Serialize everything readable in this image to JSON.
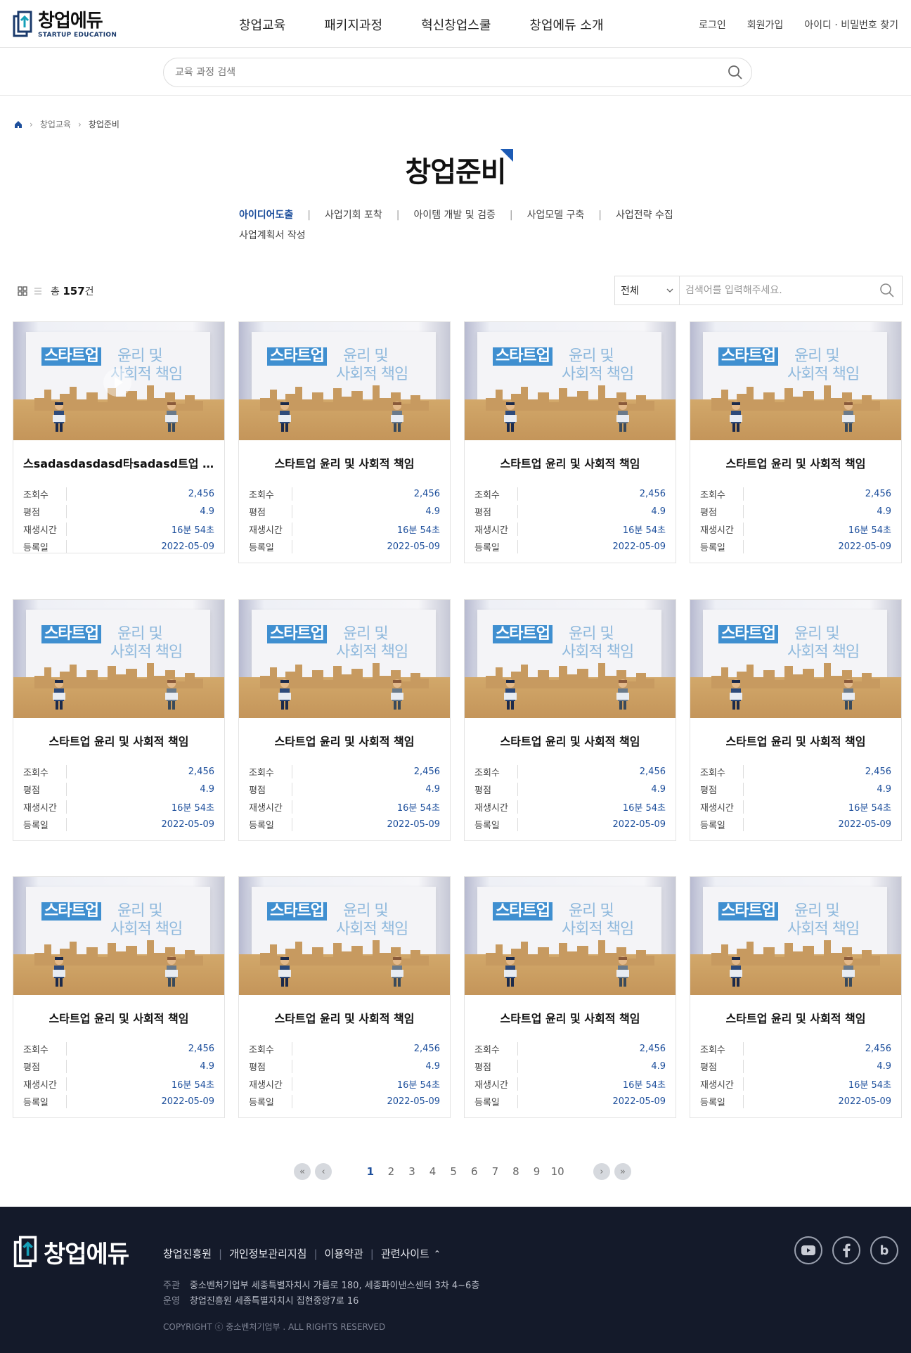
{
  "header": {
    "logo_title": "창업에듀",
    "logo_sub": "STARTUP EDUCATION",
    "nav": [
      "창업교육",
      "패키지과정",
      "혁신창업스쿨",
      "창업에듀 소개"
    ],
    "util": [
      "로그인",
      "회원가입",
      "아이디 · 비밀번호 찾기"
    ]
  },
  "top_search": {
    "placeholder": "교육 과정 검색"
  },
  "breadcrumb": {
    "level1": "창업교육",
    "current": "창업준비"
  },
  "page_title": "창업준비",
  "categories": [
    {
      "label": "아이디어도출",
      "active": true
    },
    {
      "label": "사업기회 포착",
      "active": false
    },
    {
      "label": "아이템 개발 및 검증",
      "active": false
    },
    {
      "label": "사업모델 구축",
      "active": false
    },
    {
      "label": "사업전략 수집",
      "active": false
    },
    {
      "label": "사업계획서 작성",
      "active": false
    }
  ],
  "list": {
    "total_prefix": "총",
    "total_count": "157",
    "total_suffix": "건",
    "filter_select": "전체",
    "filter_placeholder": "검색어를 입력해주세요."
  },
  "thumbnail": {
    "line1a": "스타트업",
    "line1b": "윤리 및",
    "line2": "사회적 책임"
  },
  "meta_labels": {
    "views": "조회수",
    "rating": "평점",
    "duration": "재생시간",
    "date": "등록일"
  },
  "cards": [
    {
      "title": "스sadasdasdasd타sadasd트업 윤리 및 사회적 책임",
      "views": "2,456",
      "rating": "4.9",
      "duration": "16분 54초",
      "date": "2022-05-09"
    },
    {
      "title": "스타트업 윤리 및 사회적 책임",
      "views": "2,456",
      "rating": "4.9",
      "duration": "16분 54초",
      "date": "2022-05-09"
    },
    {
      "title": "스타트업 윤리 및 사회적 책임",
      "views": "2,456",
      "rating": "4.9",
      "duration": "16분 54초",
      "date": "2022-05-09"
    },
    {
      "title": "스타트업 윤리 및 사회적 책임",
      "views": "2,456",
      "rating": "4.9",
      "duration": "16분 54초",
      "date": "2022-05-09"
    },
    {
      "title": "스타트업 윤리 및 사회적 책임",
      "views": "2,456",
      "rating": "4.9",
      "duration": "16분 54초",
      "date": "2022-05-09"
    },
    {
      "title": "스타트업 윤리 및 사회적 책임",
      "views": "2,456",
      "rating": "4.9",
      "duration": "16분 54초",
      "date": "2022-05-09"
    },
    {
      "title": "스타트업 윤리 및 사회적 책임",
      "views": "2,456",
      "rating": "4.9",
      "duration": "16분 54초",
      "date": "2022-05-09"
    },
    {
      "title": "스타트업 윤리 및 사회적 책임",
      "views": "2,456",
      "rating": "4.9",
      "duration": "16분 54초",
      "date": "2022-05-09"
    },
    {
      "title": "스타트업 윤리 및 사회적 책임",
      "views": "2,456",
      "rating": "4.9",
      "duration": "16분 54초",
      "date": "2022-05-09"
    },
    {
      "title": "스타트업 윤리 및 사회적 책임",
      "views": "2,456",
      "rating": "4.9",
      "duration": "16분 54초",
      "date": "2022-05-09"
    },
    {
      "title": "스타트업 윤리 및 사회적 책임",
      "views": "2,456",
      "rating": "4.9",
      "duration": "16분 54초",
      "date": "2022-05-09"
    },
    {
      "title": "스타트업 윤리 및 사회적 책임",
      "views": "2,456",
      "rating": "4.9",
      "duration": "16분 54초",
      "date": "2022-05-09"
    }
  ],
  "pagination": {
    "pages": [
      "1",
      "2",
      "3",
      "4",
      "5",
      "6",
      "7",
      "8",
      "9",
      "10"
    ],
    "current": "1"
  },
  "footer": {
    "logo_title": "창업에듀",
    "links": [
      "창업진흥원",
      "개인정보관리지침",
      "이용약관",
      "관련사이트"
    ],
    "host_label": "주관",
    "host_text": "중소벤처기업부   세종특별자치시 가름로 180, 세종파이낸스센터 3차 4~6층",
    "operator_label": "운영",
    "operator_text": "창업진흥원   세종특별자치시 집현중앙7로 16",
    "copyright": "COPYRIGHT ⓒ 중소벤처기업부 . ALL RIGHTS RESERVED",
    "sns": [
      "youtube-icon",
      "facebook-icon",
      "blog-icon"
    ],
    "blog_letter": "b"
  },
  "colors": {
    "accent": "#1d4f9c",
    "footer_bg": "#141a2a",
    "thumb_title_bg": "#3f8fd0"
  }
}
